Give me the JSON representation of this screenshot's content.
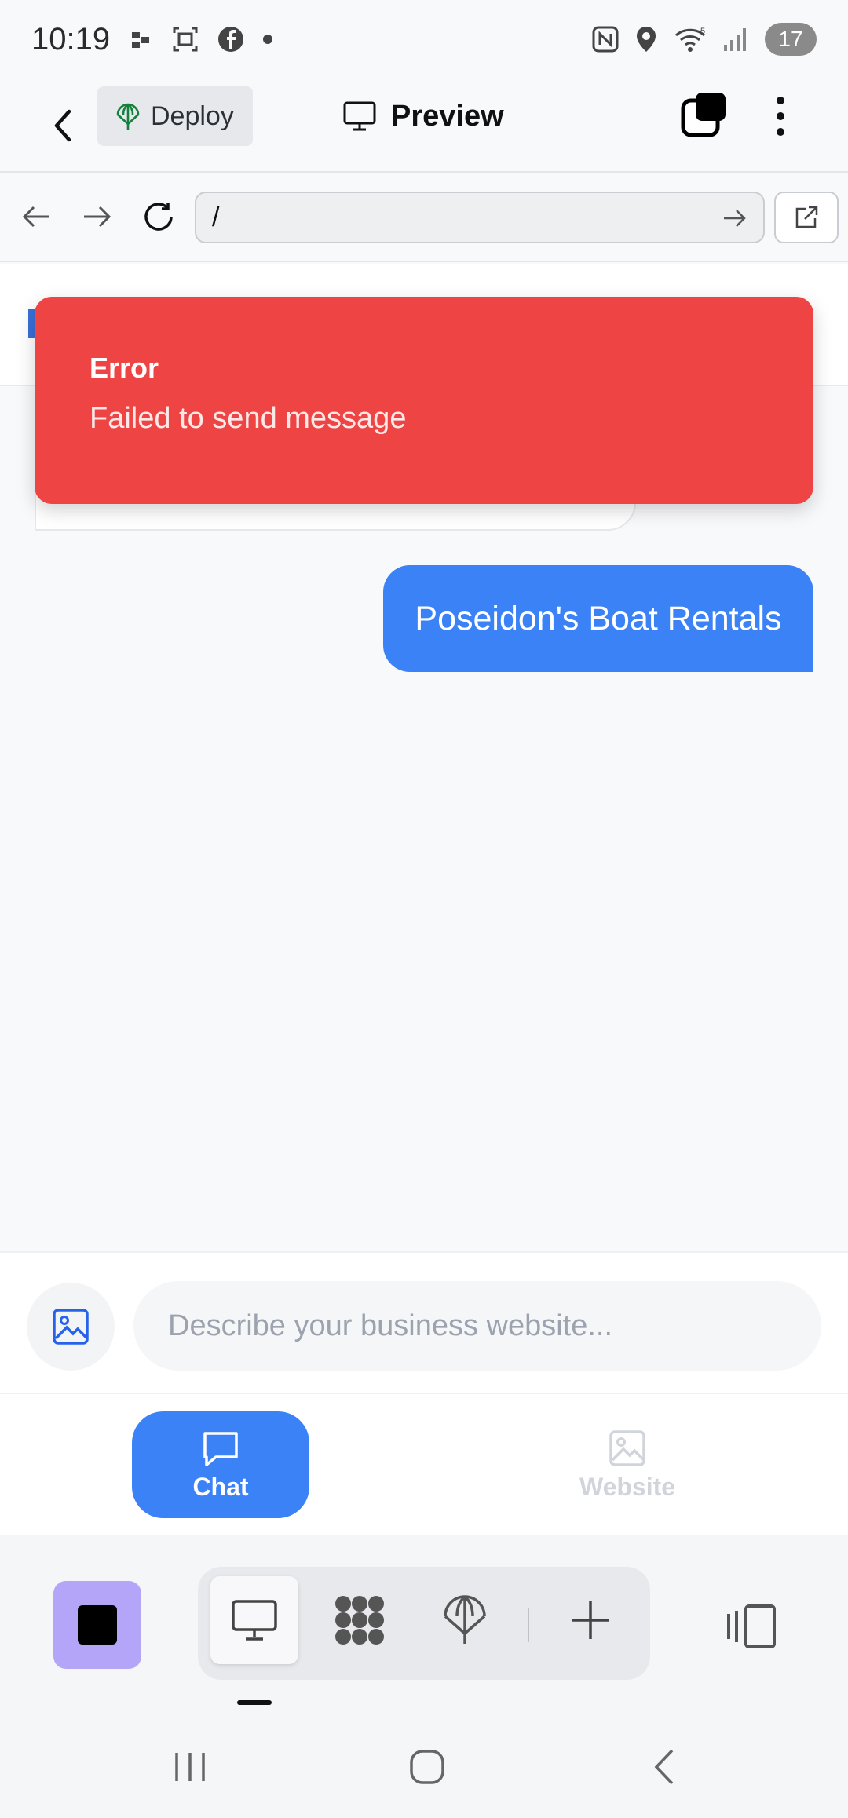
{
  "status_bar": {
    "time": "10:19",
    "battery": "17",
    "icons": [
      "screencast-icon",
      "screenshot-icon",
      "facebook-icon",
      "dot-icon",
      "nfc-icon",
      "location-icon",
      "wifi-icon",
      "signal-icon"
    ]
  },
  "header": {
    "deploy_label": "Deploy",
    "title": "Preview"
  },
  "browser": {
    "url": "/"
  },
  "toast": {
    "title": "Error",
    "message": "Failed to send message",
    "color": "#ef4444"
  },
  "chat": {
    "user_message": "Poseidon's Boat Rentals",
    "bubble_color": "#3b82f6"
  },
  "composer": {
    "placeholder": "Describe your business website..."
  },
  "mode_tabs": {
    "chat_label": "Chat",
    "website_label": "Website",
    "active": "Chat"
  },
  "dock": {
    "items": [
      "monitor-icon",
      "apps-icon",
      "deploy-icon",
      "add-icon"
    ],
    "active": "monitor-icon"
  },
  "colors": {
    "accent": "#3b82f6",
    "error": "#ef4444",
    "app_icon_bg": "#b4a5f8"
  }
}
